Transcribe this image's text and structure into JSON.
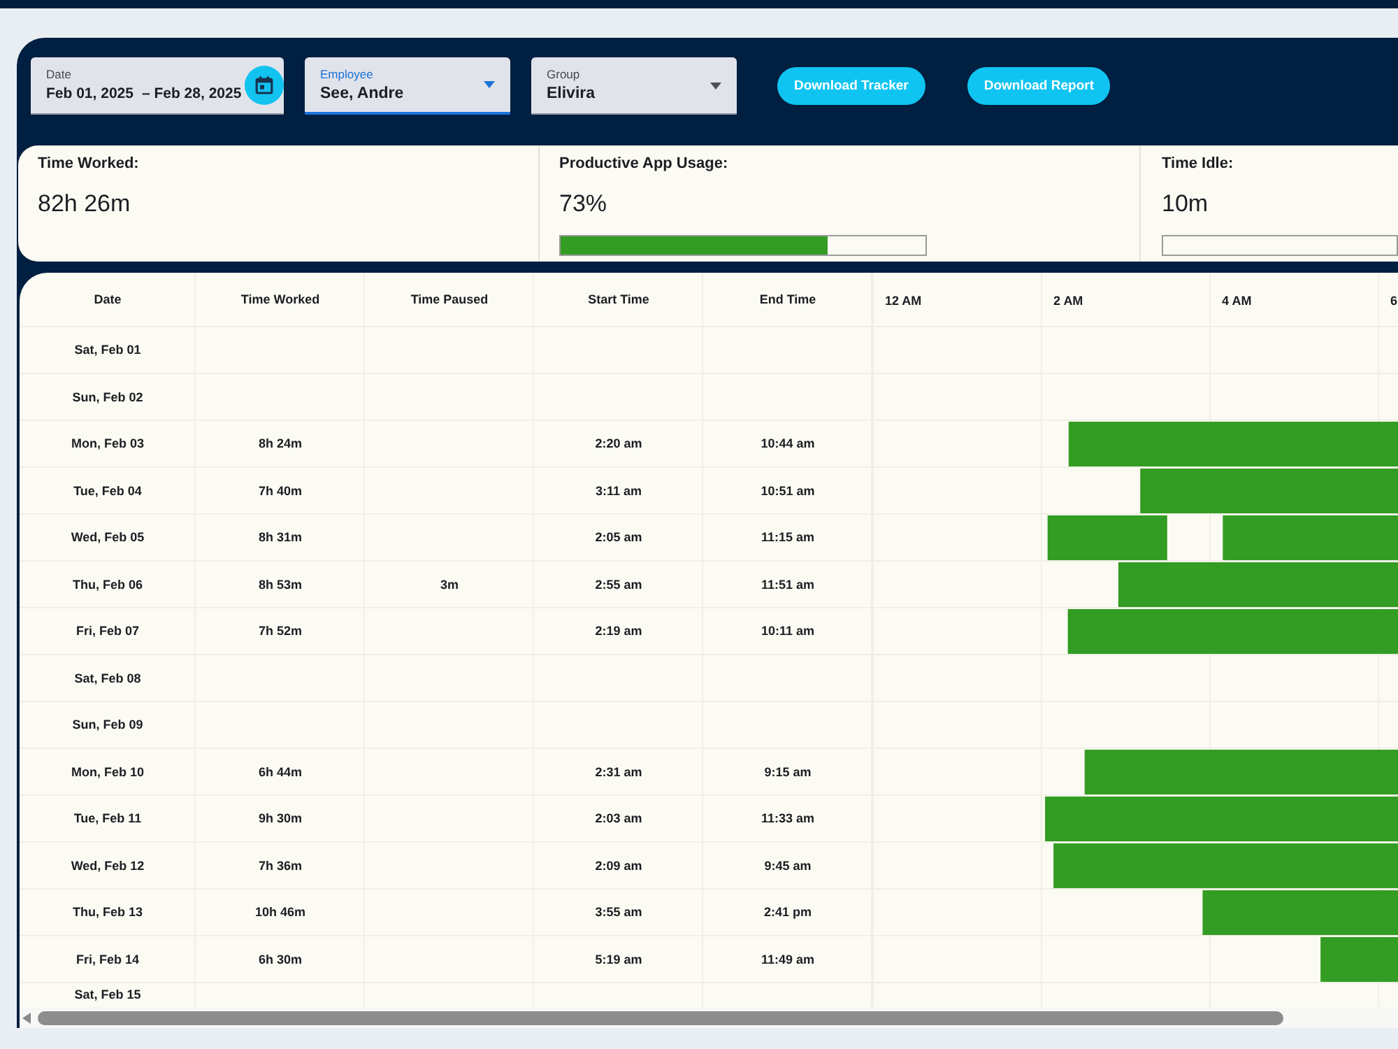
{
  "filters": [
    {
      "kind": "date_range",
      "label": "Date",
      "start": "Feb 01, 2025",
      "end": "– Feb 28, 2025",
      "focused": false
    },
    {
      "kind": "select",
      "label": "Employee",
      "value": "See, Andre",
      "focused": true
    },
    {
      "kind": "select",
      "label": "Group",
      "value": "Elivira",
      "focused": false
    }
  ],
  "buttons": [
    "Download Tracker",
    "Download Report"
  ],
  "stats": [
    {
      "kind": "value",
      "label": "Time Worked:",
      "value": "82h 26m"
    },
    {
      "kind": "meter",
      "label": "Productive App Usage:",
      "value": "73%",
      "level": 0.73
    },
    {
      "kind": "meter",
      "label": "Time Idle:",
      "value": "10m",
      "level": 0
    }
  ],
  "table": {
    "columns": [
      "Date",
      "Time Worked",
      "Time Paused",
      "Start Time",
      "End Time"
    ],
    "rows": [
      {
        "date": "Sat, Feb 01"
      },
      {
        "date": "Sun, Feb 02"
      },
      {
        "date": "Mon, Feb 03",
        "time_worked": "8h 24m",
        "start_time": "2:20 am",
        "end_time": "10:44 am"
      },
      {
        "date": "Tue, Feb 04",
        "time_worked": "7h 40m",
        "start_time": "3:11 am",
        "end_time": "10:51 am"
      },
      {
        "date": "Wed, Feb 05",
        "time_worked": "8h 31m",
        "start_time": "2:05 am",
        "end_time": "11:15 am"
      },
      {
        "date": "Thu, Feb 06",
        "time_worked": "8h 53m",
        "time_paused": "3m",
        "start_time": "2:55 am",
        "end_time": "11:51 am"
      },
      {
        "date": "Fri, Feb 07",
        "time_worked": "7h 52m",
        "start_time": "2:19 am",
        "end_time": "10:11 am"
      },
      {
        "date": "Sat, Feb 08"
      },
      {
        "date": "Sun, Feb 09"
      },
      {
        "date": "Mon, Feb 10",
        "time_worked": "6h 44m",
        "start_time": "2:31 am",
        "end_time": "9:15 am"
      },
      {
        "date": "Tue, Feb 11",
        "time_worked": "9h 30m",
        "start_time": "2:03 am",
        "end_time": "11:33 am"
      },
      {
        "date": "Wed, Feb 12",
        "time_worked": "7h 36m",
        "start_time": "2:09 am",
        "end_time": "9:45 am"
      },
      {
        "date": "Thu, Feb 13",
        "time_worked": "10h 46m",
        "start_time": "3:55 am",
        "end_time": "2:41 pm"
      },
      {
        "date": "Fri, Feb 14",
        "time_worked": "6h 30m",
        "start_time": "5:19 am",
        "end_time": "11:49 am"
      },
      {
        "date": "Sat, Feb 15"
      }
    ]
  },
  "timeline": {
    "hour_labels": [
      "12 AM",
      "2 AM",
      "4 AM",
      "6"
    ]
  }
}
